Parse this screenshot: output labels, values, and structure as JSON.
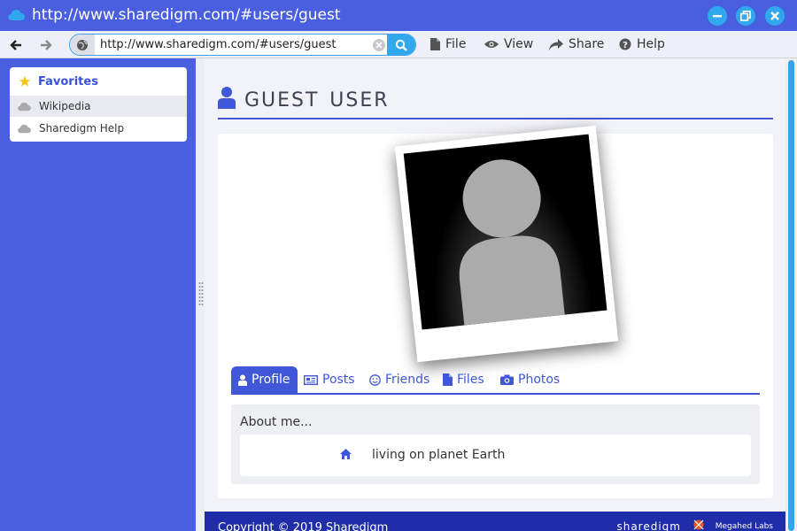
{
  "window": {
    "title": "http://www.sharedigm.com/#users/guest"
  },
  "toolbar": {
    "url_value": "http://www.sharedigm.com/#users/guest",
    "menu": {
      "file": "File",
      "view": "View",
      "share": "Share",
      "help": "Help"
    }
  },
  "sidebar": {
    "favorites_title": "Favorites",
    "items": [
      {
        "label": "Wikipedia",
        "icon": "cloud-icon"
      },
      {
        "label": "Sharedigm Help",
        "icon": "cloud-icon"
      }
    ]
  },
  "main": {
    "page_title": "Guest User",
    "tabs": [
      {
        "label": "Profile",
        "icon": "user-icon"
      },
      {
        "label": "Posts",
        "icon": "newspaper-icon"
      },
      {
        "label": "Friends",
        "icon": "smile-icon"
      },
      {
        "label": "Files",
        "icon": "file-icon"
      },
      {
        "label": "Photos",
        "icon": "camera-icon"
      }
    ],
    "about_label": "About me...",
    "about_text": "living on planet Earth"
  },
  "footer": {
    "copyright": "Copyright © 2019 Sharedigm",
    "brand": "sharedigm",
    "company": "Megahed Labs"
  },
  "colors": {
    "accent": "#4a5fe0",
    "link": "#3f57d8",
    "button": "#2fa8ee",
    "footer": "#1f2da8"
  }
}
